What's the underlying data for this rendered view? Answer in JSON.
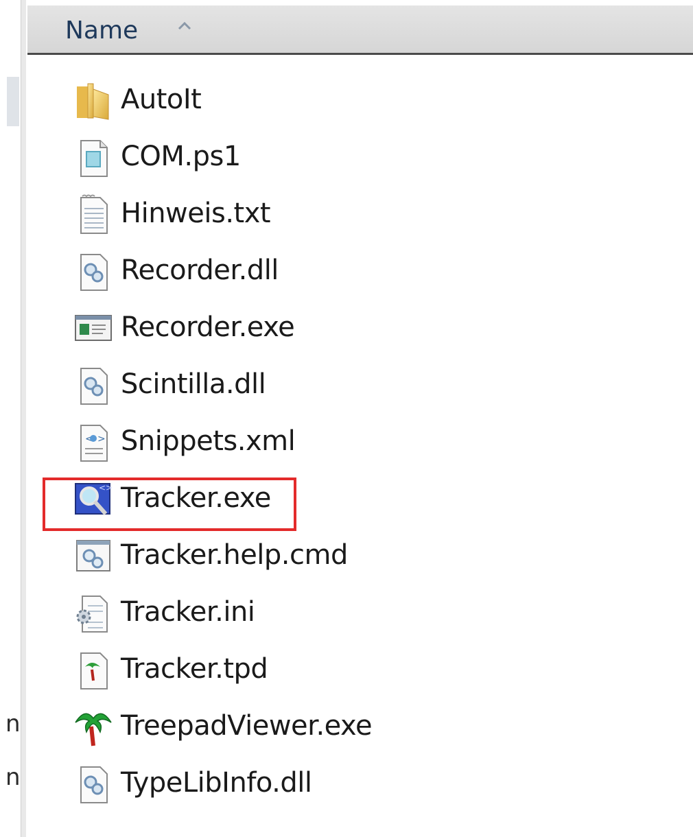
{
  "header": {
    "name_column_label": "Name",
    "sort_indicator": "sort-ascending-icon"
  },
  "nav_fragments": [
    "n",
    "n"
  ],
  "files": [
    {
      "name": "AutoIt",
      "icon": "folder-icon"
    },
    {
      "name": "COM.ps1",
      "icon": "script-file-icon"
    },
    {
      "name": "Hinweis.txt",
      "icon": "text-file-icon"
    },
    {
      "name": "Recorder.dll",
      "icon": "dll-file-icon"
    },
    {
      "name": "Recorder.exe",
      "icon": "exe-window-icon"
    },
    {
      "name": "Scintilla.dll",
      "icon": "dll-file-icon"
    },
    {
      "name": "Snippets.xml",
      "icon": "xml-file-icon"
    },
    {
      "name": "Tracker.exe",
      "icon": "tracker-magnifier-icon",
      "highlighted": true
    },
    {
      "name": "Tracker.help.cmd",
      "icon": "cmd-file-icon"
    },
    {
      "name": "Tracker.ini",
      "icon": "ini-settings-file-icon"
    },
    {
      "name": "Tracker.tpd",
      "icon": "treepad-file-icon"
    },
    {
      "name": "TreepadViewer.exe",
      "icon": "palm-tree-icon"
    },
    {
      "name": "TypeLibInfo.dll",
      "icon": "dll-file-icon"
    }
  ],
  "colors": {
    "highlight_border": "#e32b2b",
    "header_text": "#1e395b"
  }
}
